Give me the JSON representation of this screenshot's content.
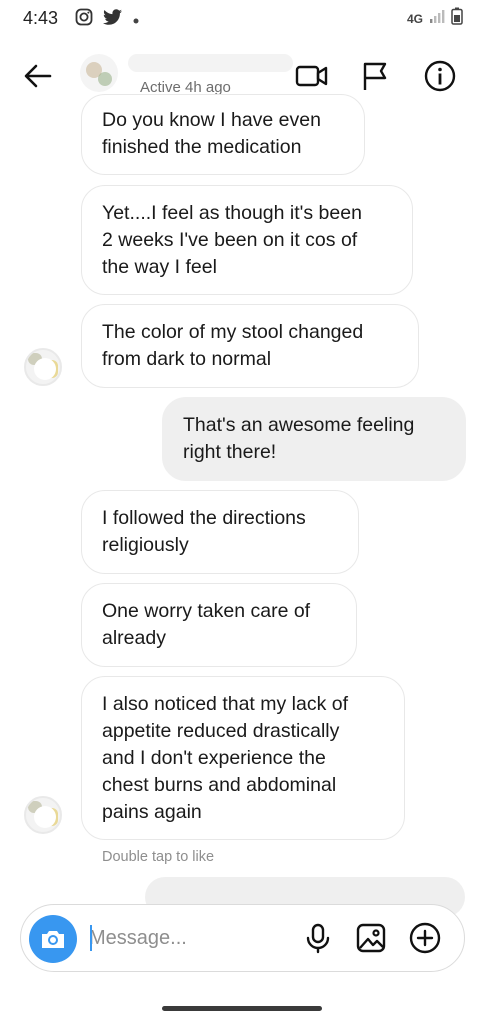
{
  "status_bar": {
    "time": "4:43",
    "network": "4G"
  },
  "header": {
    "active_status": "Active 4h ago"
  },
  "messages": [
    {
      "direction": "received",
      "text": "Do you know I have even\nfinished the medication"
    },
    {
      "direction": "received",
      "text": "Yet....I feel as though it's been\n2 weeks I've been on it cos of\nthe way I feel"
    },
    {
      "direction": "received",
      "text": "The color of my stool changed\nfrom dark to normal"
    },
    {
      "direction": "sent",
      "text": "That's an awesome feeling\nright there!"
    },
    {
      "direction": "received",
      "text": "I followed the directions\nreligiously"
    },
    {
      "direction": "received",
      "text": "One worry taken care of\nalready"
    },
    {
      "direction": "received",
      "text": "I also noticed that my lack of\nappetite reduced drastically\nand I don't experience the\nchest burns and abdominal\npains again"
    }
  ],
  "double_tap_hint": "Double tap to like",
  "composer": {
    "placeholder": "Message..."
  },
  "colors": {
    "accent": "#3897f0",
    "sent_bubble": "#efefef",
    "received_border": "#e8e8e8"
  }
}
